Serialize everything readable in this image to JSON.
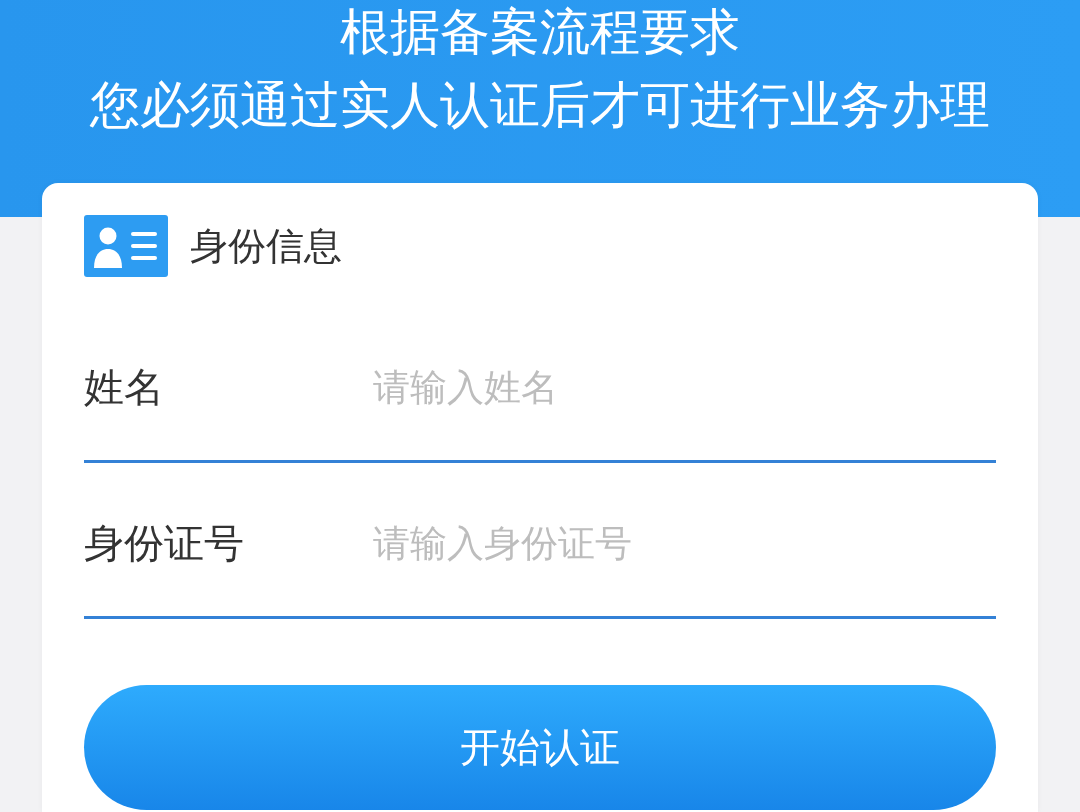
{
  "header": {
    "lines": [
      "根据备案流程要求",
      "您必须通过实人认证后才可进行业务办理"
    ]
  },
  "card": {
    "title": "身份信息",
    "fields": [
      {
        "label": "姓名",
        "placeholder": "请输入姓名"
      },
      {
        "label": "身份证号",
        "placeholder": "请输入身份证号"
      }
    ],
    "button": "开始认证"
  }
}
